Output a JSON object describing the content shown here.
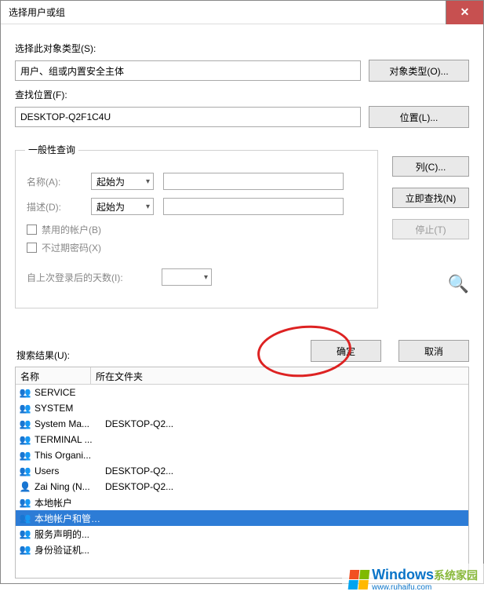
{
  "dialog": {
    "title": "选择用户或组",
    "close": "✕"
  },
  "object_type": {
    "label": "选择此对象类型(S):",
    "value": "用户、组或内置安全主体",
    "button": "对象类型(O)..."
  },
  "location": {
    "label": "查找位置(F):",
    "value": "DESKTOP-Q2F1C4U",
    "button": "位置(L)..."
  },
  "advanced": {
    "tab": "一般性查询",
    "name_label": "名称(A):",
    "name_combo": "起始为",
    "desc_label": "描述(D):",
    "desc_combo": "起始为",
    "disabled_acc": "禁用的帐户(B)",
    "no_expire": "不过期密码(X)",
    "days_since_login": "自上次登录后的天数(I):"
  },
  "side": {
    "columns": "列(C)...",
    "find_now": "立即查找(N)",
    "stop": "停止(T)"
  },
  "actions": {
    "ok": "确定",
    "cancel": "取消",
    "results_label": "搜索结果(U):"
  },
  "columns": {
    "name": "名称",
    "folder": "所在文件夹"
  },
  "results": [
    {
      "icon": "👥",
      "name": "SERVICE",
      "folder": ""
    },
    {
      "icon": "👥",
      "name": "SYSTEM",
      "folder": ""
    },
    {
      "icon": "👥",
      "name": "System Ma...",
      "folder": "DESKTOP-Q2..."
    },
    {
      "icon": "👥",
      "name": "TERMINAL ...",
      "folder": ""
    },
    {
      "icon": "👥",
      "name": "This Organi...",
      "folder": ""
    },
    {
      "icon": "👥",
      "name": "Users",
      "folder": "DESKTOP-Q2..."
    },
    {
      "icon": "👤",
      "name": "Zai Ning (N...",
      "folder": "DESKTOP-Q2..."
    },
    {
      "icon": "👥",
      "name": "本地帐户",
      "folder": ""
    },
    {
      "icon": "👥",
      "name": "本地帐户和管理员组成员",
      "folder": "",
      "selected": true
    },
    {
      "icon": "👥",
      "name": "服务声明的...",
      "folder": ""
    },
    {
      "icon": "👥",
      "name": "身份验证机...",
      "folder": ""
    }
  ],
  "watermark": {
    "brand": "Windows",
    "sub": "系统家园",
    "url": "www.ruhaifu.com"
  }
}
